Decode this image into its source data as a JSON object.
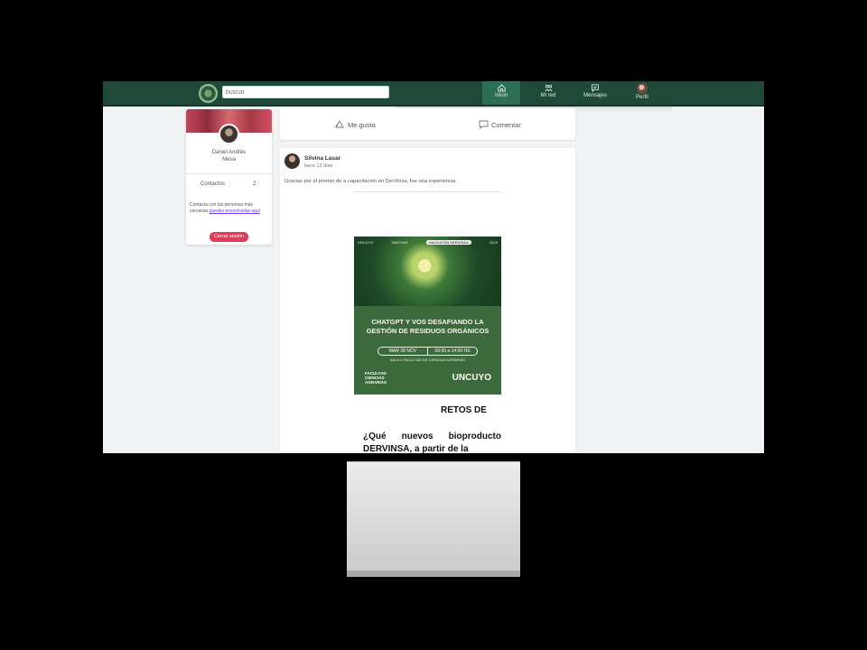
{
  "header": {
    "search_placeholder": "buscar",
    "nav": [
      {
        "label": "Inicio",
        "icon": "home-icon",
        "active": true
      },
      {
        "label": "Mi red",
        "icon": "network-icon",
        "active": false
      },
      {
        "label": "Mensajes",
        "icon": "message-icon",
        "active": false
      },
      {
        "label": "Perfil",
        "icon": "avatar",
        "active": false
      }
    ]
  },
  "profile": {
    "name_line1": "Daniel Andrés",
    "name_line2": "Mesa",
    "contacts_label": "Contactos",
    "contacts_count": "2",
    "contact_text": "Contacta con las personas más cercanas",
    "contact_link": "puedes encontrarlas aquí",
    "logout_label": "Cerrar sesión"
  },
  "actions": {
    "like_label": "Me gusta",
    "comment_label": "Comentar"
  },
  "post": {
    "author": "Silvina Lasar",
    "time": "hace 13 días",
    "text": "Gracias por el premio de a capacitación en DerVinsa, fue una experiencia.",
    "poster": {
      "org": "UNCUYO",
      "tag": "INNOVAR",
      "pill": "HACKATÓN DERVINSA",
      "year": "2023",
      "title_line1": "CHATGPT Y VOS DESAFIANDO LA",
      "title_line2": "GESTIÓN DE RESIDUOS ORGÁNICOS",
      "date": "MAR 28 NOV",
      "hours": "09:00 a 14:00 HS",
      "place": "AULA 4 FACULTAD DE CIENCIAS AGRARIAS",
      "faculty_line1": "FACULTAD",
      "faculty_line2": "CIENCIAS",
      "faculty_line3": "AGRARIAS",
      "brand": "UNCUYO"
    },
    "retos": "RETOS DE",
    "question": "¿Qué nuevos bioproducto DERVINSA, a partir de la"
  },
  "colors": {
    "topbar": "#1f4a3a",
    "active_nav": "#2d6e55",
    "logout": "#e23a5b",
    "link": "#6a3fd6"
  }
}
